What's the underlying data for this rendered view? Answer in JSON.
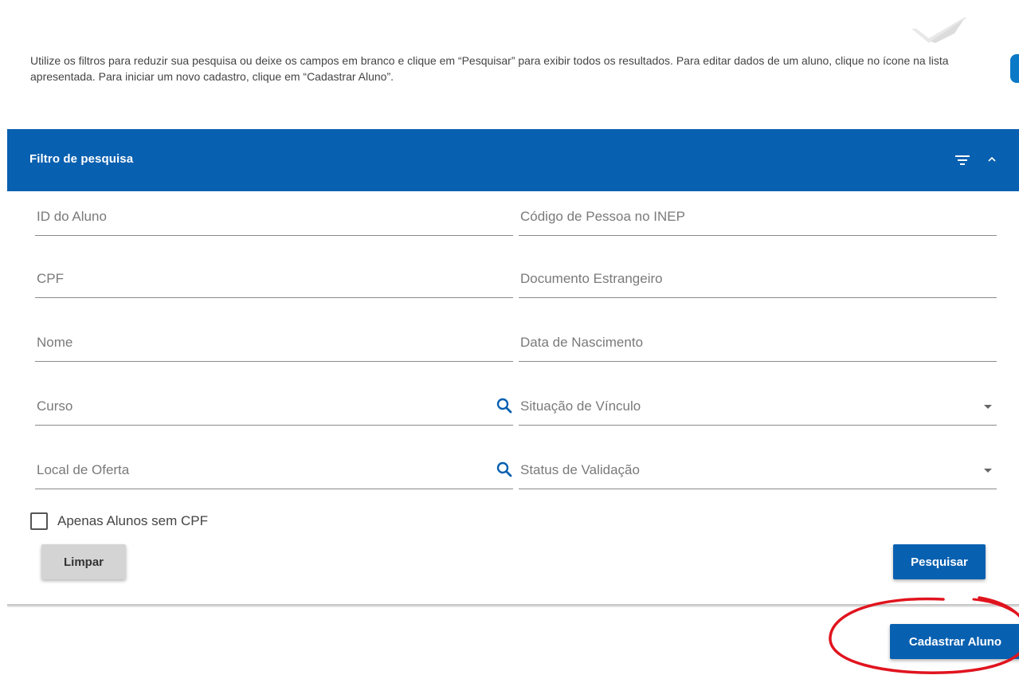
{
  "intro": {
    "text": "Utilize os filtros para reduzir sua pesquisa ou deixe os campos em branco e clique em “Pesquisar” para exibir todos os resultados. Para editar dados de um aluno, clique no ícone na lista apresentada. Para iniciar um novo cadastro, clique em “Cadastrar Aluno”."
  },
  "panel": {
    "title": "Filtro de pesquisa",
    "filter_icon": "filter-list-icon",
    "collapse_icon": "chevron-up-icon"
  },
  "fields": {
    "student_id": {
      "placeholder": "ID do Aluno",
      "value": ""
    },
    "inep_code": {
      "placeholder": "Código de Pessoa no INEP",
      "value": ""
    },
    "cpf": {
      "placeholder": "CPF",
      "value": ""
    },
    "foreign_doc": {
      "placeholder": "Documento Estrangeiro",
      "value": ""
    },
    "name": {
      "placeholder": "Nome",
      "value": ""
    },
    "birth_date": {
      "placeholder": "Data de Nascimento",
      "value": ""
    },
    "course": {
      "placeholder": "Curso",
      "value": "",
      "icon": "search-icon"
    },
    "enrollment_status": {
      "placeholder": "Situação de Vínculo",
      "value": "",
      "icon": "dropdown-caret-icon"
    },
    "offer_location": {
      "placeholder": "Local de Oferta",
      "value": "",
      "icon": "search-icon"
    },
    "validation_status": {
      "placeholder": "Status de Validação",
      "value": "",
      "icon": "dropdown-caret-icon"
    }
  },
  "checkbox": {
    "label": "Apenas Alunos sem CPF",
    "checked": false
  },
  "buttons": {
    "clear": "Limpar",
    "search": "Pesquisar",
    "register": "Cadastrar Aluno"
  },
  "colors": {
    "primary": "#0860b0",
    "button_gray": "#d4d4d4",
    "annotation_red": "#e0141e"
  }
}
